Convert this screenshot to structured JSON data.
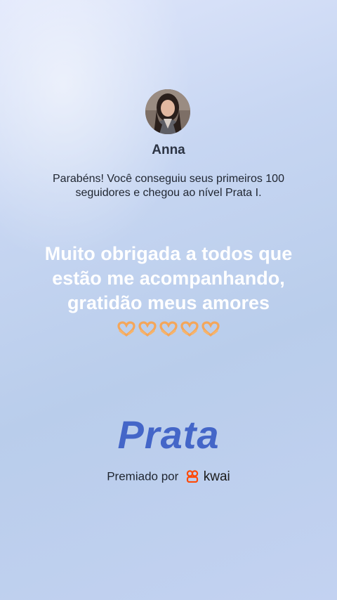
{
  "profile": {
    "name": "Anna",
    "avatar_icon": "profile-photo"
  },
  "notification": {
    "message": "Parabéns! Você conseguiu seus primeiros 100 seguidores e chegou ao nível Prata I."
  },
  "post": {
    "caption": "Muito obrigada a todos que estão me acompanhando, gratidão meus amores",
    "emoji": "🫶",
    "emoji_count": 5
  },
  "achievement": {
    "level": "Prata",
    "awarded_by_label": "Premiado por",
    "brand_name": "kwai",
    "brand_color": "#ff4906"
  },
  "colors": {
    "level_text": "#4466c8",
    "background_start": "#dfe6fb",
    "background_end": "#c3d2f1"
  }
}
